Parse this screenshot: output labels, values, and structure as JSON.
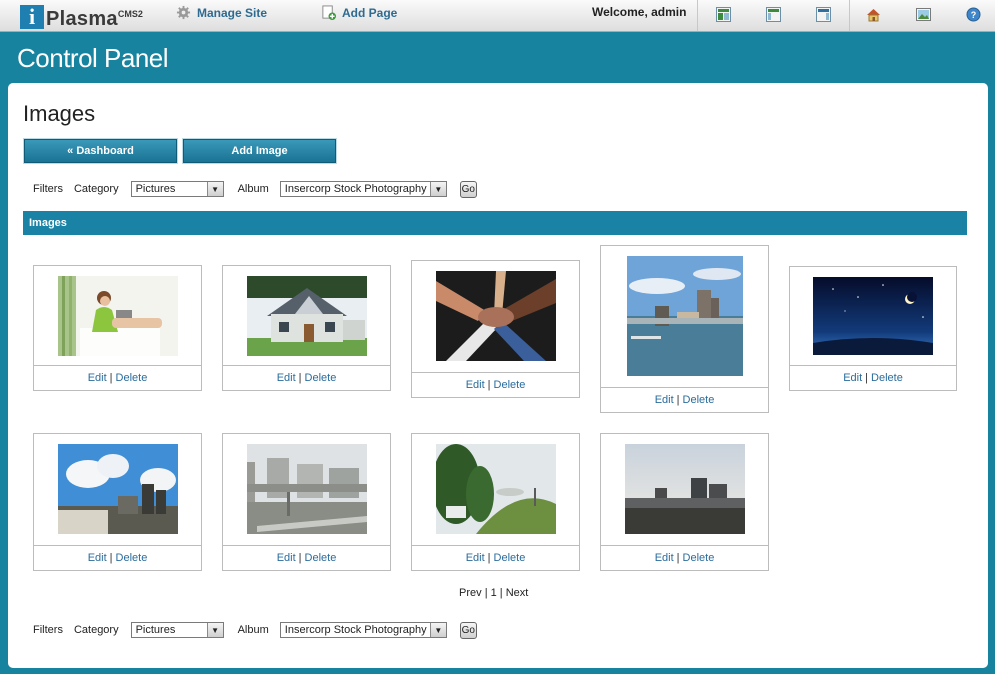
{
  "topbar": {
    "logo_letter": "i",
    "logo_text": "Plasma",
    "logo_sup": "CMS2",
    "manage_site": "Manage Site",
    "add_page": "Add Page",
    "welcome": "Welcome, admin",
    "icons": [
      "layout-icon-1",
      "layout-icon-2",
      "layout-icon-3",
      "home-icon",
      "image-icon",
      "help-icon"
    ]
  },
  "header": {
    "title": "Control Panel"
  },
  "page": {
    "title": "Images"
  },
  "buttons": {
    "dashboard": "« Dashboard",
    "add_image": "Add Image"
  },
  "filters": {
    "label": "Filters",
    "category_label": "Category",
    "category_value": "Pictures",
    "album_label": "Album",
    "album_value": "Insercorp Stock Photography",
    "go": "Go"
  },
  "section": {
    "title": "Images"
  },
  "actions": {
    "edit": "Edit",
    "sep": "|",
    "delete": "Delete"
  },
  "images": [
    {
      "subject": "woman with laptop"
    },
    {
      "subject": "house"
    },
    {
      "subject": "stacked hands"
    },
    {
      "subject": "waterfront city"
    },
    {
      "subject": "night sky with moon"
    },
    {
      "subject": "industrial plant"
    },
    {
      "subject": "highway overpass"
    },
    {
      "subject": "hill with trees"
    },
    {
      "subject": "city skyline by river"
    }
  ],
  "pager": {
    "prev": "Prev",
    "sep": "|",
    "page": "1",
    "next": "Next"
  }
}
